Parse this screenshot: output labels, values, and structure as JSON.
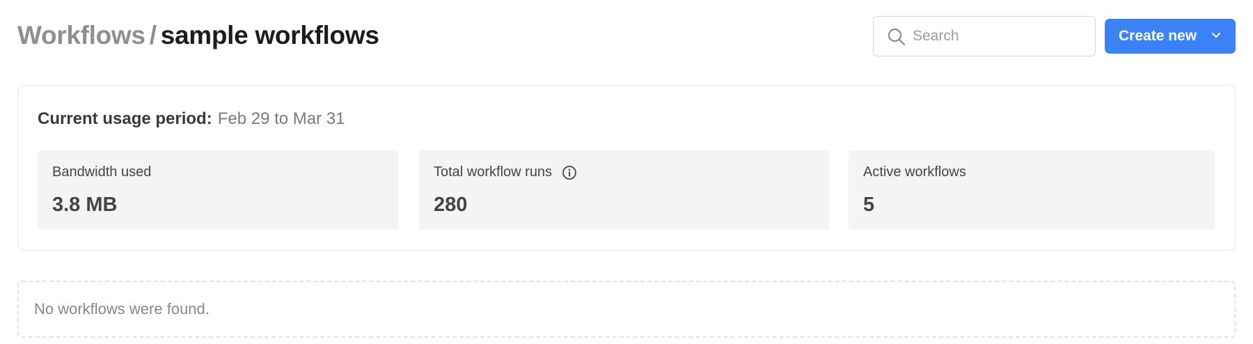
{
  "header": {
    "breadcrumb_root": "Workflows",
    "breadcrumb_separator": "/",
    "breadcrumb_current": "sample workflows"
  },
  "search": {
    "placeholder": "Search",
    "icon": "search-icon"
  },
  "create_button": {
    "label": "Create new",
    "icon": "chevron-down-icon",
    "color": "#3b82f6"
  },
  "usage": {
    "period_label": "Current usage period:",
    "period_value": "Feb 29 to Mar 31",
    "stats": [
      {
        "label": "Bandwidth used",
        "value": "3.8 MB"
      },
      {
        "label": "Total workflow runs",
        "value": "280",
        "icon": "info-icon"
      },
      {
        "label": "Active workflows",
        "value": "5"
      }
    ]
  },
  "empty_state": {
    "message": "No workflows were found."
  }
}
